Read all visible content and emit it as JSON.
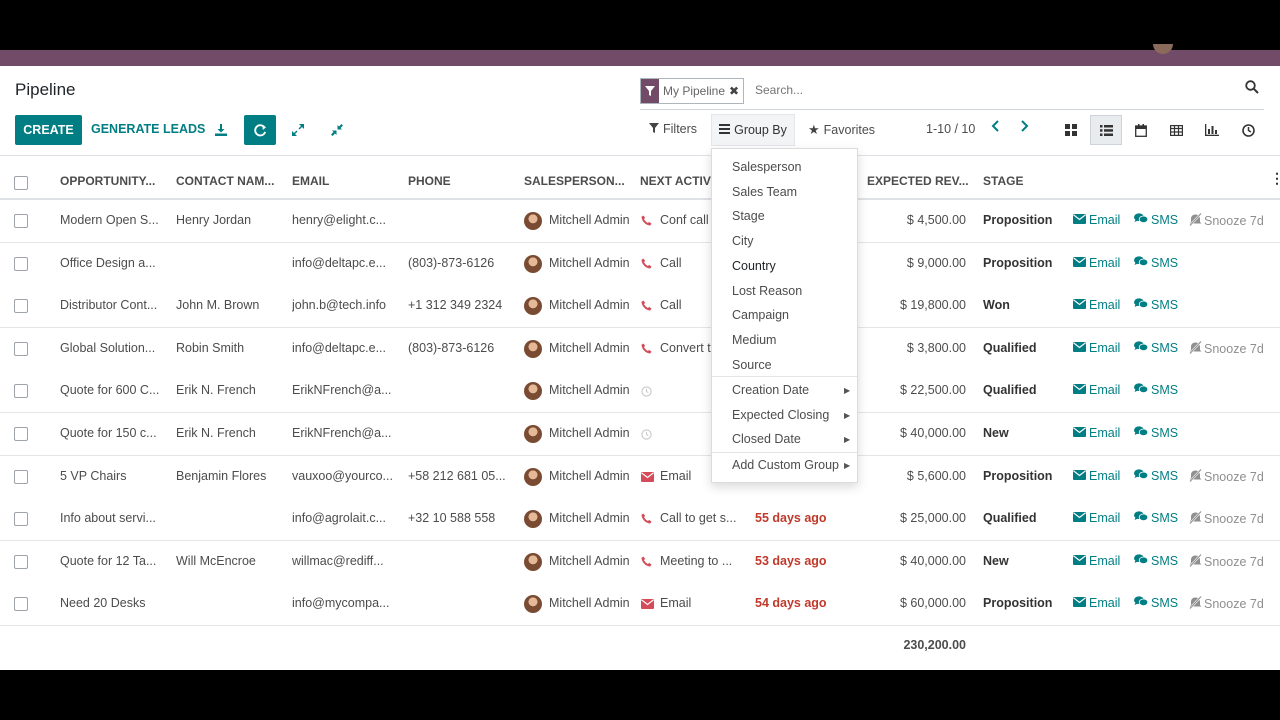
{
  "header": {
    "title": "Pipeline",
    "create_label": "CREATE",
    "generate_label": "GENERATE LEADS"
  },
  "search": {
    "facet": "My Pipeline",
    "placeholder": "Search..."
  },
  "toolbar": {
    "filters": "Filters",
    "group_by": "Group By",
    "favorites": "Favorites",
    "pager": "1-10 / 10"
  },
  "columns": {
    "opportunity": "OPPORTUNITY...",
    "contact": "CONTACT NAM...",
    "email": "EMAIL",
    "phone": "PHONE",
    "salesperson": "SALESPERSON...",
    "next_activity": "NEXT ACTIV",
    "expected_revenue": "EXPECTED REV...",
    "stage": "STAGE"
  },
  "rows": [
    {
      "opportunity": "Modern Open S...",
      "contact": "Henry Jordan",
      "email": "henry@elight.c...",
      "phone": "",
      "salesperson": "Mitchell Admin",
      "activity_icon": "phone",
      "activity": "Conf call",
      "deadline": "",
      "revenue": "$ 4,500.00",
      "stage": "Proposition",
      "email_action": "Email",
      "sms_action": "SMS",
      "snooze": "Snooze 7d"
    },
    {
      "opportunity": "Office Design a...",
      "contact": "",
      "email": "info@deltapc.e...",
      "phone": "(803)-873-6126",
      "salesperson": "Mitchell Admin",
      "activity_icon": "phone",
      "activity": "Call",
      "deadline": "",
      "revenue": "$ 9,000.00",
      "stage": "Proposition",
      "email_action": "Email",
      "sms_action": "SMS",
      "snooze": ""
    },
    {
      "opportunity": "Distributor Cont...",
      "contact": "John M. Brown",
      "email": "john.b@tech.info",
      "phone": "+1 312 349 2324",
      "salesperson": "Mitchell Admin",
      "activity_icon": "phone",
      "activity": "Call",
      "deadline": "",
      "revenue": "$ 19,800.00",
      "stage": "Won",
      "email_action": "Email",
      "sms_action": "SMS",
      "snooze": ""
    },
    {
      "opportunity": "Global Solution...",
      "contact": "Robin Smith",
      "email": "info@deltapc.e...",
      "phone": "(803)-873-6126",
      "salesperson": "Mitchell Admin",
      "activity_icon": "phone",
      "activity": "Convert t",
      "deadline": "",
      "revenue": "$ 3,800.00",
      "stage": "Qualified",
      "email_action": "Email",
      "sms_action": "SMS",
      "snooze": "Snooze 7d"
    },
    {
      "opportunity": "Quote for 600 C...",
      "contact": "Erik N. French",
      "email": "ErikNFrench@a...",
      "phone": "",
      "salesperson": "Mitchell Admin",
      "activity_icon": "clock",
      "activity": "",
      "deadline": "",
      "revenue": "$ 22,500.00",
      "stage": "Qualified",
      "email_action": "Email",
      "sms_action": "SMS",
      "snooze": ""
    },
    {
      "opportunity": "Quote for 150 c...",
      "contact": "Erik N. French",
      "email": "ErikNFrench@a...",
      "phone": "",
      "salesperson": "Mitchell Admin",
      "activity_icon": "clock",
      "activity": "",
      "deadline": "",
      "revenue": "$ 40,000.00",
      "stage": "New",
      "email_action": "Email",
      "sms_action": "SMS",
      "snooze": ""
    },
    {
      "opportunity": "5 VP Chairs",
      "contact": "Benjamin Flores",
      "email": "vauxoo@yourco...",
      "phone": "+58 212 681 05...",
      "salesperson": "Mitchell Admin",
      "activity_icon": "mail",
      "activity": "Email",
      "deadline": "",
      "revenue": "$ 5,600.00",
      "stage": "Proposition",
      "email_action": "Email",
      "sms_action": "SMS",
      "snooze": "Snooze 7d"
    },
    {
      "opportunity": "Info about servi...",
      "contact": "",
      "email": "info@agrolait.c...",
      "phone": "+32 10 588 558",
      "salesperson": "Mitchell Admin",
      "activity_icon": "phone",
      "activity": "Call to get s...",
      "deadline": "55 days ago",
      "revenue": "$ 25,000.00",
      "stage": "Qualified",
      "email_action": "Email",
      "sms_action": "SMS",
      "snooze": "Snooze 7d"
    },
    {
      "opportunity": "Quote for 12 Ta...",
      "contact": "Will McEncroe",
      "email": "willmac@rediff...",
      "phone": "",
      "salesperson": "Mitchell Admin",
      "activity_icon": "phone",
      "activity": "Meeting to ...",
      "deadline": "53 days ago",
      "revenue": "$ 40,000.00",
      "stage": "New",
      "email_action": "Email",
      "sms_action": "SMS",
      "snooze": "Snooze 7d"
    },
    {
      "opportunity": "Need 20 Desks",
      "contact": "",
      "email": "info@mycompa...",
      "phone": "",
      "salesperson": "Mitchell Admin",
      "activity_icon": "mail",
      "activity": "Email",
      "deadline": "54 days ago",
      "revenue": "$ 60,000.00",
      "stage": "Proposition",
      "email_action": "Email",
      "sms_action": "SMS",
      "snooze": "Snooze 7d"
    }
  ],
  "total_revenue": "230,200.00",
  "group_by_menu": {
    "items": [
      "Salesperson",
      "Sales Team",
      "Stage",
      "City",
      "Country",
      "Lost Reason",
      "Campaign",
      "Medium",
      "Source"
    ],
    "date_items": [
      "Creation Date",
      "Expected Closing",
      "Closed Date"
    ],
    "custom": "Add Custom Group"
  },
  "colors": {
    "brand": "#714b67",
    "accent": "#017e84",
    "overdue": "#c0392b"
  }
}
